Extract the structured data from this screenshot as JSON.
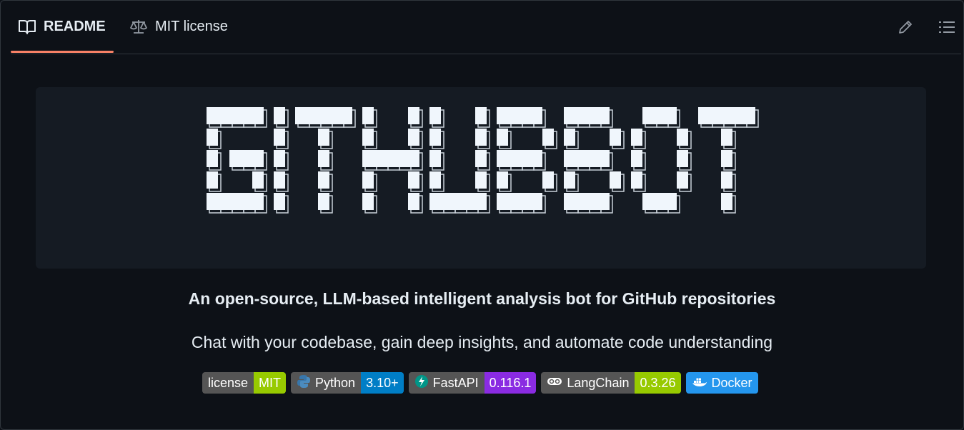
{
  "tabs": [
    {
      "label": "README",
      "icon": "book-icon",
      "active": true
    },
    {
      "label": "MIT license",
      "icon": "scale-icon",
      "active": false
    }
  ],
  "toolbar": {
    "edit_icon": "pencil-icon",
    "outline_icon": "list-icon"
  },
  "banner": {
    "ascii_title": "GITHUBBOT"
  },
  "readme": {
    "tagline": "An open-source, LLM-based intelligent analysis bot for GitHub repositories",
    "subline": "Chat with your codebase, gain deep insights, and automate code understanding"
  },
  "badges": [
    {
      "label": "license",
      "value": "MIT",
      "value_color": "#97ca00"
    },
    {
      "label": "Python",
      "value": "3.10+",
      "value_color": "#007ec6",
      "icon": "python-icon"
    },
    {
      "label": "FastAPI",
      "value": "0.116.1",
      "value_color": "#8a2be2",
      "icon": "fastapi-icon",
      "label_color": "#009688"
    },
    {
      "label": "LangChain",
      "value": "0.3.26",
      "value_color": "#97ca00",
      "icon": "langchain-icon"
    },
    {
      "label": "Docker",
      "icon": "docker-icon",
      "color": "#2496ed"
    }
  ],
  "colors": {
    "accent": "#f78166",
    "background": "#0d1117",
    "banner": "#151b23"
  }
}
